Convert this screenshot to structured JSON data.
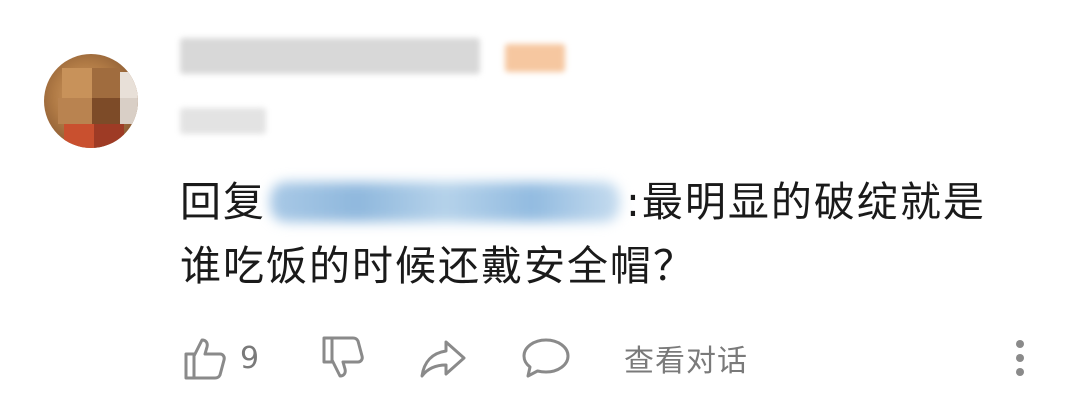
{
  "comment": {
    "reply_prefix": "回复",
    "body_line1": ":最明显的破绽就是",
    "body_line2": "谁吃饭的时候还戴安全帽？"
  },
  "actions": {
    "like_count": "9",
    "view_conversation": "查看对话"
  },
  "icons": {
    "like": "thumbs-up-icon",
    "dislike": "thumbs-down-icon",
    "share": "share-arrow-icon",
    "reply": "speech-bubble-icon",
    "more": "more-vertical-icon"
  },
  "colors": {
    "text": "#1a1a1a",
    "muted": "#7a7a7a",
    "icon": "#8a8a8a",
    "blurred_link": "#8fb8dd"
  }
}
